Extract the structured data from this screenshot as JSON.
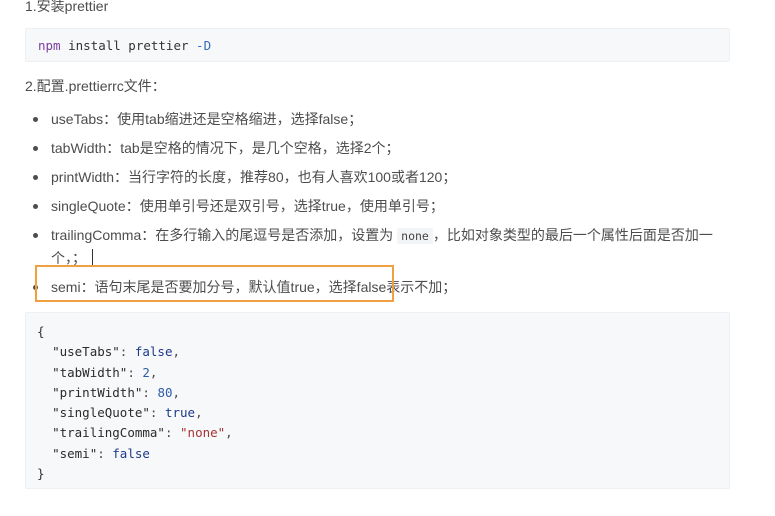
{
  "steps": {
    "step1": "1.安装prettier",
    "step2": "2.配置.prettierrc文件："
  },
  "install_cmd": {
    "cmd": "npm",
    "args": " install prettier ",
    "flag": "-D"
  },
  "options": [
    {
      "name": "useTabs",
      "desc": "：使用tab缩进还是空格缩进，选择false；"
    },
    {
      "name": "tabWidth",
      "desc": "：tab是空格的情况下，是几个空格，选择2个；"
    },
    {
      "name": "printWidth",
      "desc": "：当行字符的长度，推荐80，也有人喜欢100或者120；"
    },
    {
      "name": "singleQuote",
      "desc": "：使用单引号还是双引号，选择true，使用单引号；"
    },
    {
      "name": "trailingComma",
      "desc_before": "：在多行输入的尾逗号是否添加，设置为 ",
      "code": "none",
      "desc_after": "，比如对象类型的最后一个属性后面是否加一个，；"
    },
    {
      "name": "semi",
      "desc": "：语句末尾是否要加分号，默认值true，选择false表示不加；"
    }
  ],
  "config_code": {
    "open": "{",
    "entries": [
      {
        "key": "\"useTabs\"",
        "value": "false",
        "kind": "bool",
        "comma": ","
      },
      {
        "key": "\"tabWidth\"",
        "value": "2",
        "kind": "num",
        "comma": ","
      },
      {
        "key": "\"printWidth\"",
        "value": "80",
        "kind": "num",
        "comma": ","
      },
      {
        "key": "\"singleQuote\"",
        "value": "true",
        "kind": "bool",
        "comma": ","
      },
      {
        "key": "\"trailingComma\"",
        "value": "\"none\"",
        "kind": "str",
        "comma": ","
      },
      {
        "key": "\"semi\"",
        "value": "false",
        "kind": "bool",
        "comma": ""
      }
    ],
    "close": "}"
  },
  "colors": {
    "highlight_border": "#f0a040",
    "code_bg": "#f6f8fa"
  }
}
